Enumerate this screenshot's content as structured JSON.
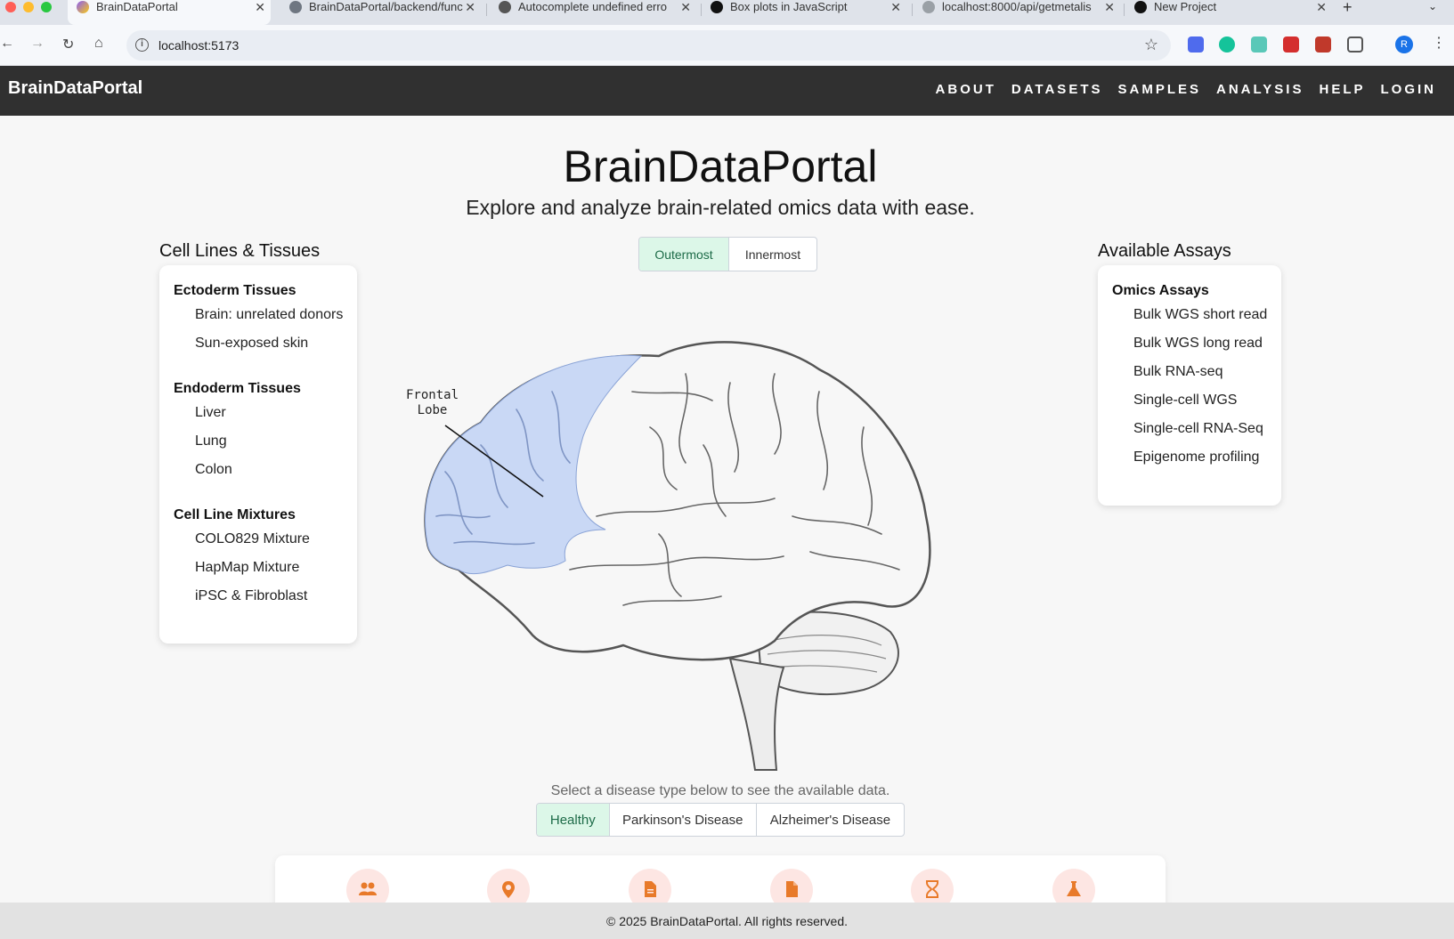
{
  "browser": {
    "tabs": [
      {
        "title": "BrainDataPortal",
        "active": true
      },
      {
        "title": "BrainDataPortal/backend/func",
        "active": false
      },
      {
        "title": "Autocomplete undefined erro",
        "active": false
      },
      {
        "title": "Box plots in JavaScript",
        "active": false
      },
      {
        "title": "localhost:8000/api/getmetalis",
        "active": false
      },
      {
        "title": "New Project",
        "active": false
      }
    ],
    "url": "localhost:5173",
    "profile_initial": "R"
  },
  "nav": {
    "brand": "BrainDataPortal",
    "links": [
      "ABOUT",
      "DATASETS",
      "SAMPLES",
      "ANALYSIS",
      "HELP",
      "LOGIN"
    ]
  },
  "hero": {
    "title": "BrainDataPortal",
    "subtitle": "Explore and analyze brain-related omics data with ease."
  },
  "left_panel": {
    "heading": "Cell Lines & Tissues",
    "groups": [
      {
        "title": "Ectoderm Tissues",
        "items": [
          "Brain: unrelated donors",
          "Sun-exposed skin"
        ]
      },
      {
        "title": "Endoderm Tissues",
        "items": [
          "Liver",
          "Lung",
          "Colon"
        ]
      },
      {
        "title": "Cell Line Mixtures",
        "items": [
          "COLO829 Mixture",
          "HapMap Mixture",
          "iPSC & Fibroblast"
        ]
      }
    ]
  },
  "right_panel": {
    "heading": "Available Assays",
    "groups": [
      {
        "title": "Omics Assays",
        "items": [
          "Bulk WGS short read",
          "Bulk WGS long read",
          "Bulk RNA-seq",
          "Single-cell WGS",
          "Single-cell RNA-Seq",
          "Epigenome profiling"
        ]
      }
    ]
  },
  "layer_toggle": {
    "options": [
      "Outermost",
      "Innermost"
    ],
    "selected": "Outermost"
  },
  "brain": {
    "label_line1": "Frontal",
    "label_line2": "Lobe",
    "highlight_color": "#c9d8f5"
  },
  "disease": {
    "prompt": "Select a disease type below to see the available data.",
    "options": [
      "Healthy",
      "Parkinson's Disease",
      "Alzheimer's Disease"
    ],
    "selected": "Healthy"
  },
  "stats_icons": [
    "people-icon",
    "location-pin-icon",
    "document-icon",
    "file-icon",
    "hourglass-icon",
    "flask-icon"
  ],
  "colors": {
    "accent": "#e87a2a",
    "selected_bg": "#dcf7e8",
    "nav_bg": "#303030"
  },
  "footer": {
    "text": "© 2025 BrainDataPortal. All rights reserved."
  }
}
